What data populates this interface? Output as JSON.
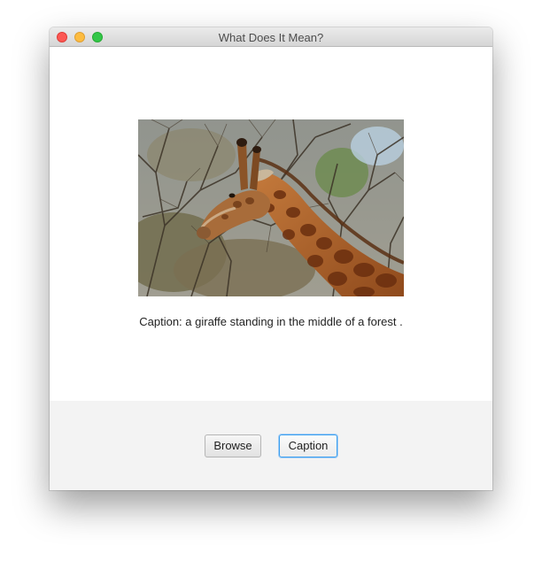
{
  "window": {
    "title": "What Does It Mean?"
  },
  "main": {
    "image_alt": "giraffe",
    "caption": "Caption: a giraffe standing in the middle of a forest ."
  },
  "footer": {
    "browse_label": "Browse",
    "caption_label": "Caption"
  }
}
